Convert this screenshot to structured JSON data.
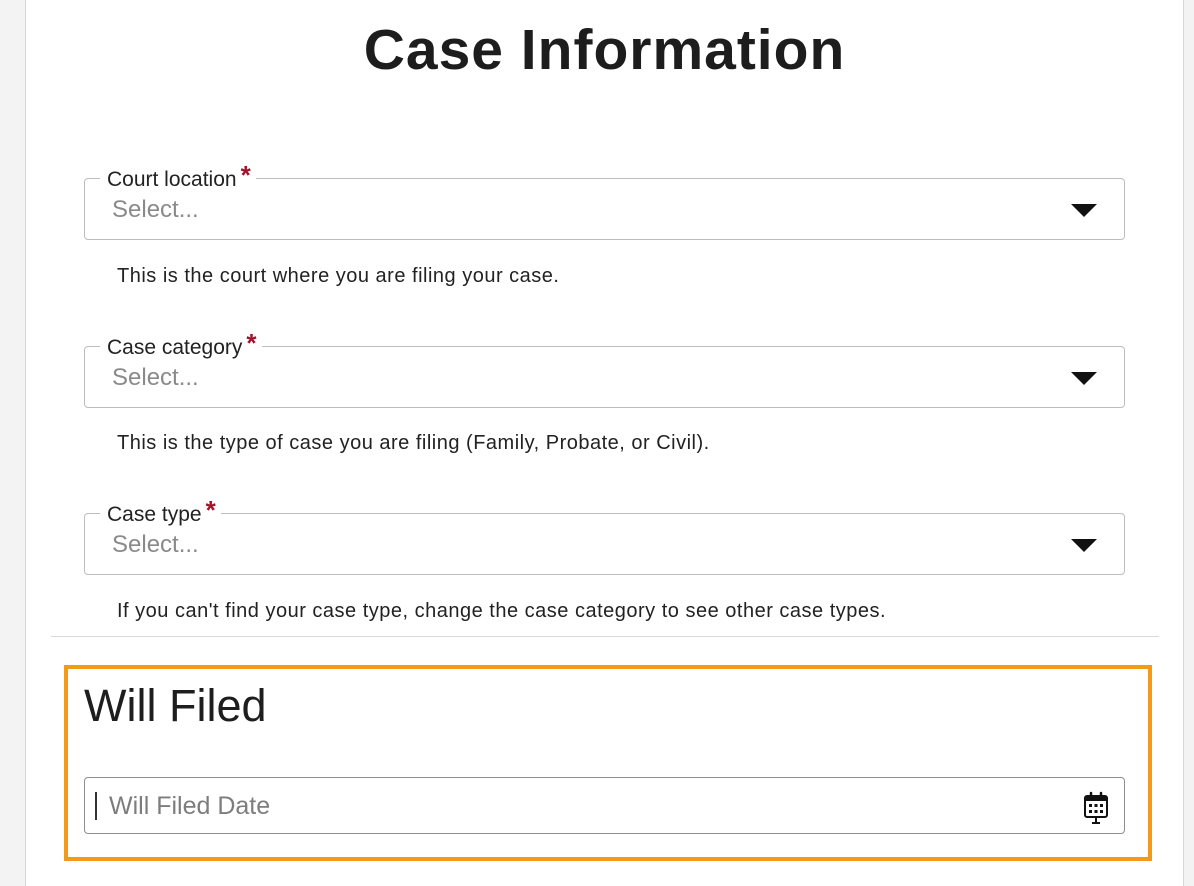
{
  "page": {
    "title": "Case Information"
  },
  "fields": [
    {
      "label": "Court location",
      "required_mark": "*",
      "placeholder": "Select...",
      "help_text": "This is the court where you are filing your case."
    },
    {
      "label": "Case category",
      "required_mark": "*",
      "placeholder": "Select...",
      "help_text": "This is the type of case you are filing (Family, Probate, or Civil)."
    },
    {
      "label": "Case type",
      "required_mark": "*",
      "placeholder": "Select...",
      "help_text": "If you can't find your case type, change the case category to see other case types."
    }
  ],
  "will_filed": {
    "title": "Will Filed",
    "date_placeholder": "Will Filed Date",
    "date_value": ""
  },
  "icons": {
    "dropdown": "caret-down-icon",
    "date": "calendar-icon"
  },
  "colors": {
    "required": "#a3122b",
    "highlight": "#f39a1b",
    "field_border": "#bdbdbd"
  }
}
